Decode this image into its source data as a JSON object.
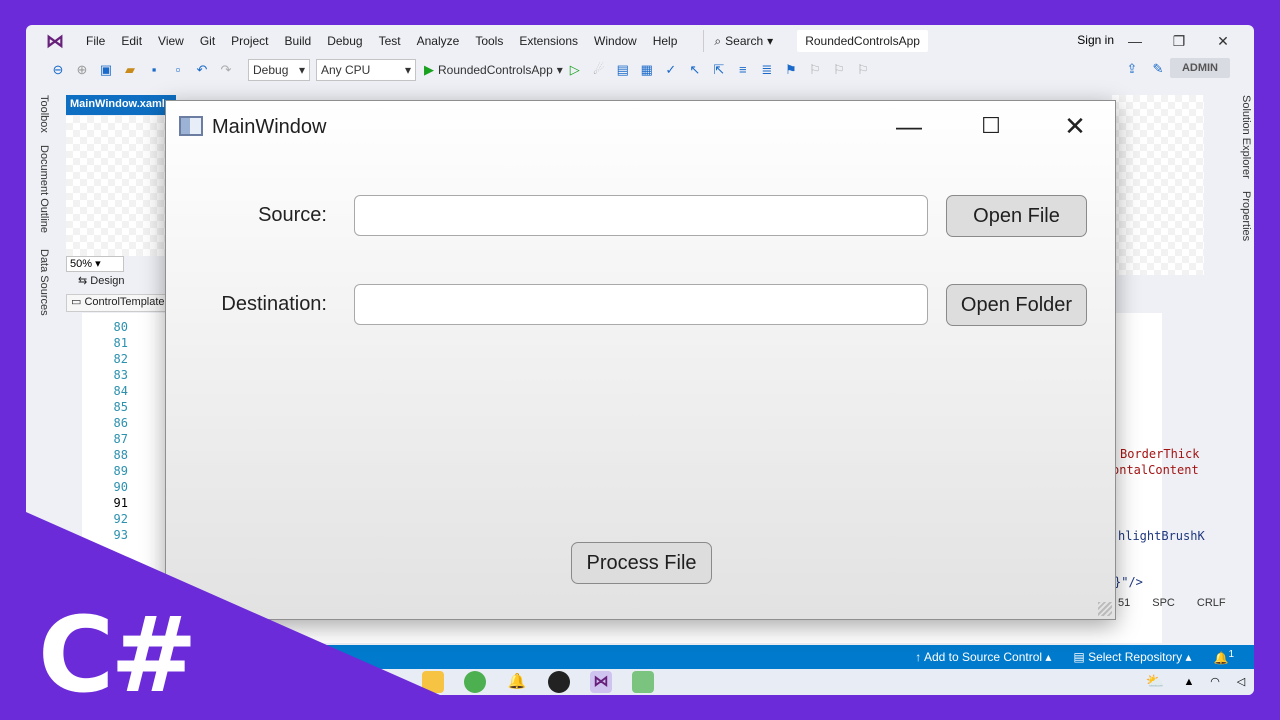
{
  "vs": {
    "logo_icon": "visual-studio-icon",
    "menu": [
      "File",
      "Edit",
      "View",
      "Git",
      "Project",
      "Build",
      "Debug",
      "Test",
      "Analyze",
      "Tools",
      "Extensions",
      "Window",
      "Help"
    ],
    "search_label": "Search",
    "solution_name": "RoundedControlsApp",
    "sign_in": "Sign in",
    "config": "Debug",
    "platform": "Any CPU",
    "run_target": "RoundedControlsApp",
    "admin_badge": "ADMIN",
    "editor_tab": "MainWindow.xaml",
    "left_tabs": [
      "Toolbox",
      "Document Outline",
      "Data Sources"
    ],
    "right_tabs": [
      "Solution Explorer",
      "Properties"
    ],
    "zoom": "50%",
    "design_label": "Design",
    "control_template": "ControlTemplate",
    "line_numbers": [
      "80",
      "81",
      "82",
      "83",
      "84",
      "85",
      "86",
      "87",
      "88",
      "89",
      "90",
      "91",
      "92",
      "93"
    ],
    "current_line": "91",
    "code_snippets": {
      "border_thick": "BorderThick",
      "horizontal_content": "ontalContent",
      "highlight_brush": "hlightBrushK",
      "closing": "}\"/>"
    },
    "status_col": "51",
    "status_spc": "SPC",
    "status_crlf": "CRLF",
    "statusbar": {
      "add_source": "Add to Source Control",
      "select_repo": "Select Repository"
    },
    "notification_count": "1"
  },
  "app": {
    "title": "MainWindow",
    "source_label": "Source:",
    "destination_label": "Destination:",
    "source_value": "",
    "destination_value": "",
    "open_file": "Open File",
    "open_folder": "Open Folder",
    "process_file": "Process File"
  },
  "badge": {
    "text": "C#",
    "color": "#6c2bd9"
  }
}
